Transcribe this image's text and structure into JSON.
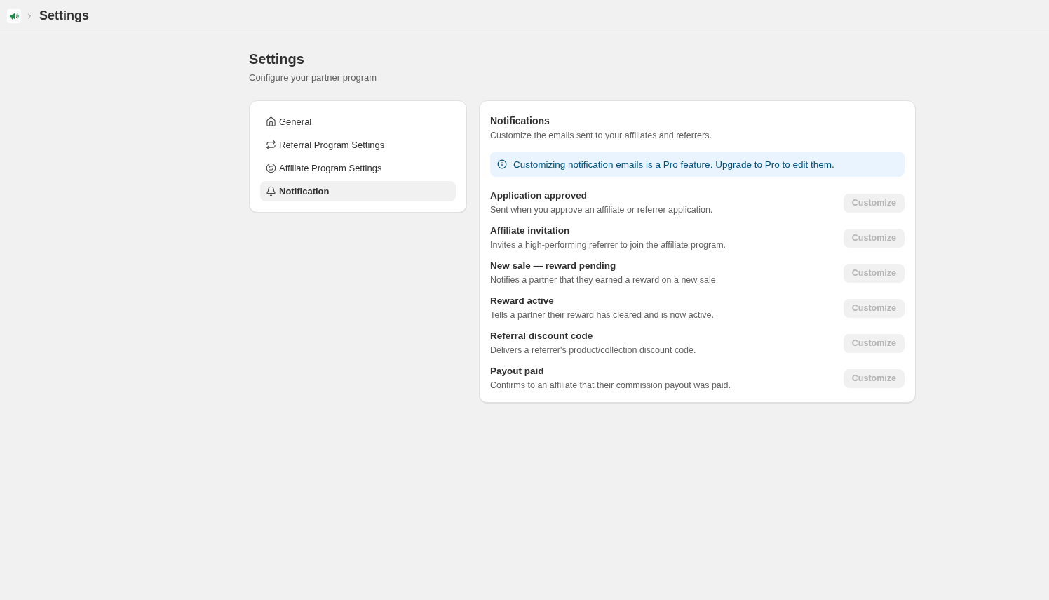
{
  "topbar": {
    "breadcrumb": "Settings"
  },
  "header": {
    "title": "Settings",
    "subtitle": "Configure your partner program"
  },
  "nav": {
    "items": [
      {
        "kind": "home",
        "label": "General",
        "selected": false
      },
      {
        "kind": "repeat",
        "label": "Referral Program Settings",
        "selected": false
      },
      {
        "kind": "dollar",
        "label": "Affiliate Program Settings",
        "selected": false
      },
      {
        "kind": "bell",
        "label": "Notification",
        "selected": true
      }
    ]
  },
  "notifications": {
    "title": "Notifications",
    "subtitle": "Customize the emails sent to your affiliates and referrers.",
    "banner": "Customizing notification emails is a Pro feature. Upgrade to Pro to edit them.",
    "rows": [
      {
        "title": "Application approved",
        "description": "Sent when you approve an affiliate or referrer application.",
        "button": {
          "label": "Customize",
          "disabled": true
        }
      },
      {
        "title": "Affiliate invitation",
        "description": "Invites a high-performing referrer to join the affiliate program.",
        "button": {
          "label": "Customize",
          "disabled": true
        }
      },
      {
        "title": "New sale — reward pending",
        "description": "Notifies a partner that they earned a reward on a new sale.",
        "button": {
          "label": "Customize",
          "disabled": true
        }
      },
      {
        "title": "Reward active",
        "description": "Tells a partner their reward has cleared and is now active.",
        "button": {
          "label": "Customize",
          "disabled": true
        }
      },
      {
        "title": "Referral discount code",
        "description": "Delivers a referrer's product/collection discount code.",
        "button": {
          "label": "Customize",
          "disabled": true
        }
      },
      {
        "title": "Payout paid",
        "description": "Confirms to an affiliate that their commission payout was paid.",
        "button": {
          "label": "Customize",
          "disabled": true
        }
      }
    ]
  }
}
